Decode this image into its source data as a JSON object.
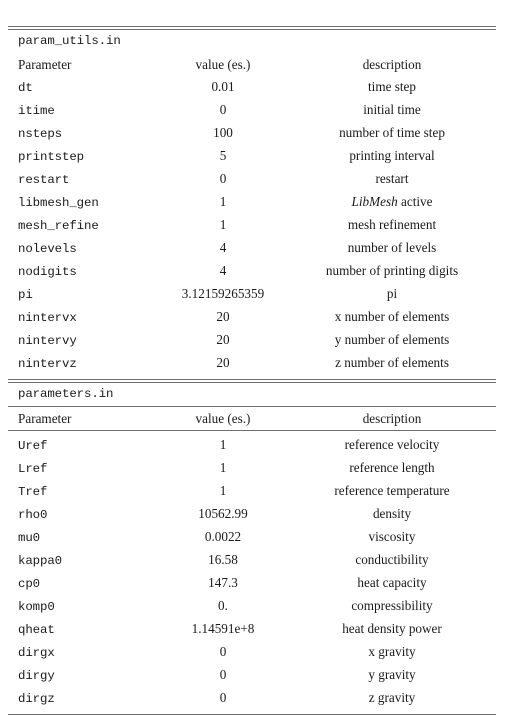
{
  "document": {
    "type": "parameter-tables",
    "tables": [
      {
        "caption": "param_utils.in",
        "headers": {
          "parameter": "Parameter",
          "value": "value (es.)",
          "description": "description"
        },
        "rows": [
          {
            "parameter": "dt",
            "value": "0.01",
            "description": "time step"
          },
          {
            "parameter": "itime",
            "value": "0",
            "description": "initial time"
          },
          {
            "parameter": "nsteps",
            "value": "100",
            "description": "number of time step"
          },
          {
            "parameter": "printstep",
            "value": "5",
            "description": "printing interval"
          },
          {
            "parameter": "restart",
            "value": "0",
            "description": "restart"
          },
          {
            "parameter": "libmesh_gen",
            "value": "1",
            "description_italic": "LibMesh",
            "description_rest": " active"
          },
          {
            "parameter": "mesh_refine",
            "value": "1",
            "description": "mesh refinement"
          },
          {
            "parameter": "nolevels",
            "value": "4",
            "description": "number of levels"
          },
          {
            "parameter": "nodigits",
            "value": "4",
            "description": "number of printing digits"
          },
          {
            "parameter": "pi",
            "value": "3.12159265359",
            "description": "pi"
          },
          {
            "parameter": "nintervx",
            "value": "20",
            "description": "x number of elements"
          },
          {
            "parameter": "nintervy",
            "value": "20",
            "description": "y number of elements"
          },
          {
            "parameter": "nintervz",
            "value": "20",
            "description": "z number of elements"
          }
        ]
      },
      {
        "caption": "parameters.in",
        "headers": {
          "parameter": "Parameter",
          "value": "value (es.)",
          "description": "description"
        },
        "rows": [
          {
            "parameter": "Uref",
            "value": "1",
            "description": "reference velocity"
          },
          {
            "parameter": "Lref",
            "value": "1",
            "description": "reference length"
          },
          {
            "parameter": "Tref",
            "value": "1",
            "description": "reference temperature"
          },
          {
            "parameter": "rho0",
            "value": "10562.99",
            "description": "density"
          },
          {
            "parameter": "mu0",
            "value": "0.0022",
            "description": "viscosity"
          },
          {
            "parameter": "kappa0",
            "value": "16.58",
            "description": "conductibility"
          },
          {
            "parameter": "cp0",
            "value": "147.3",
            "description": "heat capacity"
          },
          {
            "parameter": "komp0",
            "value": "0.",
            "description": "compressibility"
          },
          {
            "parameter": "qheat",
            "value": "1.14591e+8",
            "description": "heat density power"
          },
          {
            "parameter": "dirgx",
            "value": "0",
            "description": "x gravity"
          },
          {
            "parameter": "dirgy",
            "value": "0",
            "description": "y gravity"
          },
          {
            "parameter": "dirgz",
            "value": "0",
            "description": "z gravity"
          }
        ]
      }
    ],
    "colors": {
      "text": "#1a1a1a",
      "rule": "#6e6e6e",
      "background": "#ffffff"
    }
  }
}
